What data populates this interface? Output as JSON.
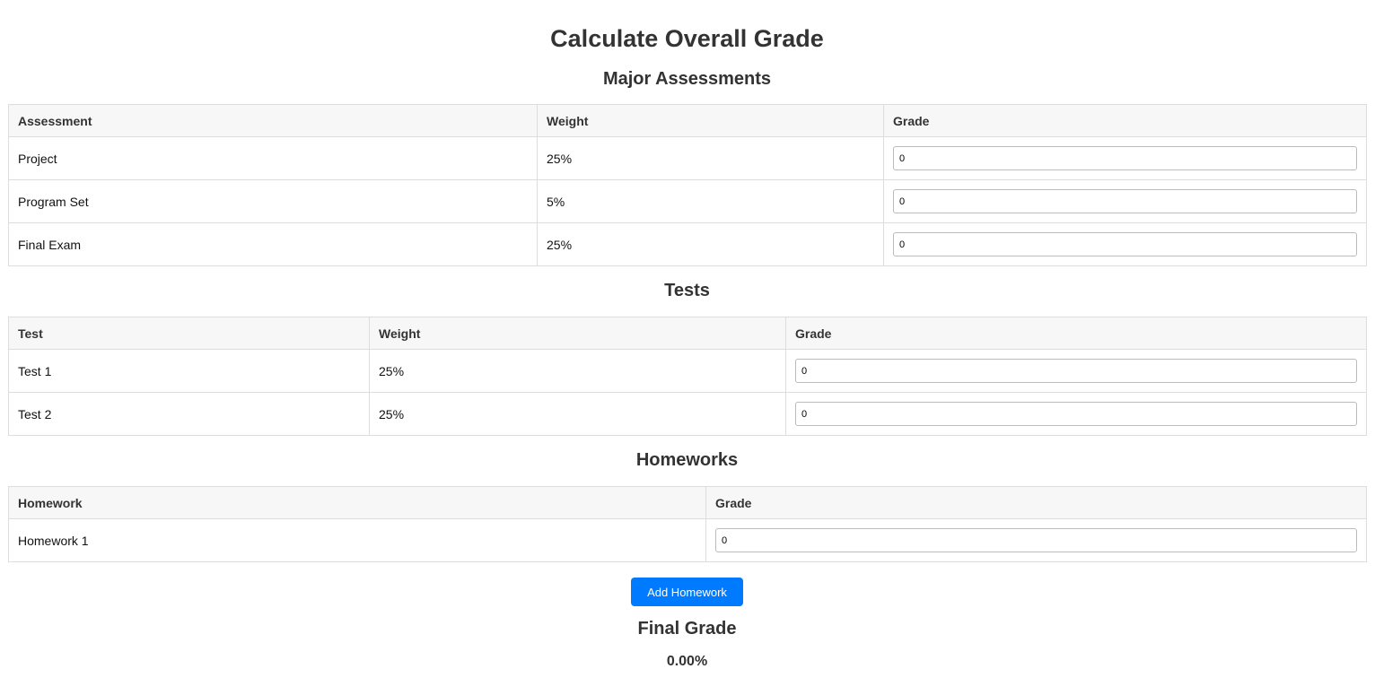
{
  "title": "Calculate Overall Grade",
  "major": {
    "heading": "Major Assessments",
    "headers": [
      "Assessment",
      "Weight",
      "Grade"
    ],
    "rows": [
      {
        "name": "Project",
        "weight": "25%",
        "grade": "0"
      },
      {
        "name": "Program Set",
        "weight": "5%",
        "grade": "0"
      },
      {
        "name": "Final Exam",
        "weight": "25%",
        "grade": "0"
      }
    ]
  },
  "tests": {
    "heading": "Tests",
    "headers": [
      "Test",
      "Weight",
      "Grade"
    ],
    "rows": [
      {
        "name": "Test 1",
        "weight": "25%",
        "grade": "0"
      },
      {
        "name": "Test 2",
        "weight": "25%",
        "grade": "0"
      }
    ]
  },
  "homeworks": {
    "heading": "Homeworks",
    "headers": [
      "Homework",
      "Grade"
    ],
    "rows": [
      {
        "name": "Homework 1",
        "grade": "0"
      }
    ],
    "add_button": "Add Homework"
  },
  "final": {
    "heading": "Final Grade",
    "value": "0.00%"
  },
  "colors": {
    "accent": "#007bff",
    "header_bg": "#f7f7f7",
    "border": "#dddddd",
    "text": "#333333"
  }
}
